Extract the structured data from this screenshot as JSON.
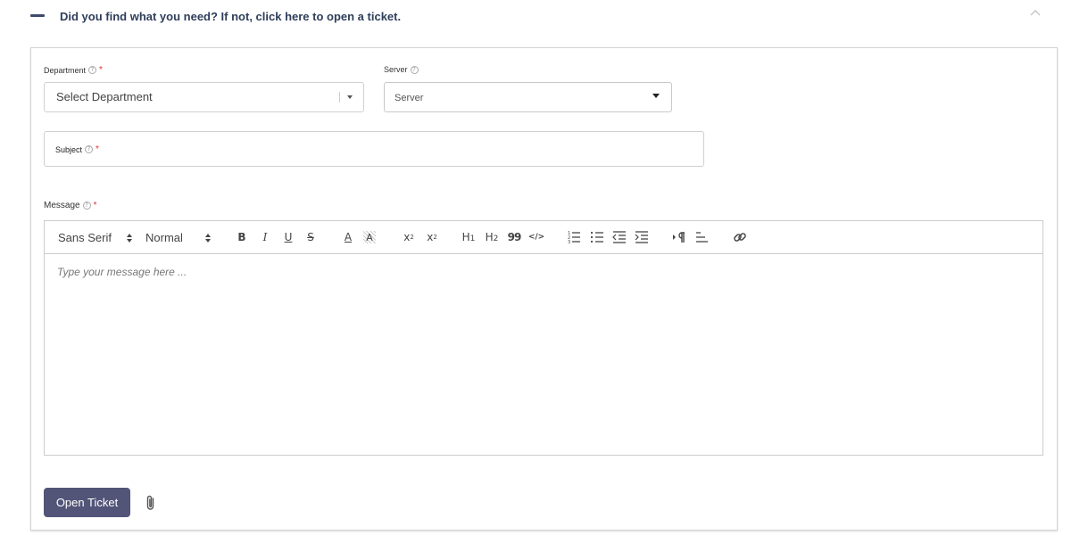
{
  "accordion": {
    "title": "Did you find what you need? If not, click here to open a ticket."
  },
  "form": {
    "department": {
      "label": "Department",
      "required_mark": "*",
      "value": "Select Department"
    },
    "server": {
      "label": "Server",
      "value": "Server"
    },
    "subject": {
      "label": "Subject",
      "required_mark": "*"
    },
    "message": {
      "label": "Message",
      "required_mark": "*",
      "placeholder": "Type your message here ...",
      "toolbar": {
        "font": "Sans Serif",
        "size": "Normal",
        "bold": "B",
        "italic": "I",
        "underline": "U",
        "strike": "S",
        "color": "A",
        "background": "A",
        "subscript": "x",
        "subscript_mark": "2",
        "superscript": "x",
        "superscript_mark": "2",
        "h1": "H",
        "h1_mark": "1",
        "h2": "H",
        "h2_mark": "2",
        "blockquote": "99",
        "code": "</>"
      }
    },
    "submit_label": "Open Ticket"
  },
  "icons": {
    "help": "?",
    "collapse": "minus-icon",
    "chevron": "chevron-up-icon",
    "attachment": "paperclip-icon"
  },
  "colors": {
    "accent": "#525478",
    "title": "#2f3e5a",
    "required": "#dd3333"
  }
}
